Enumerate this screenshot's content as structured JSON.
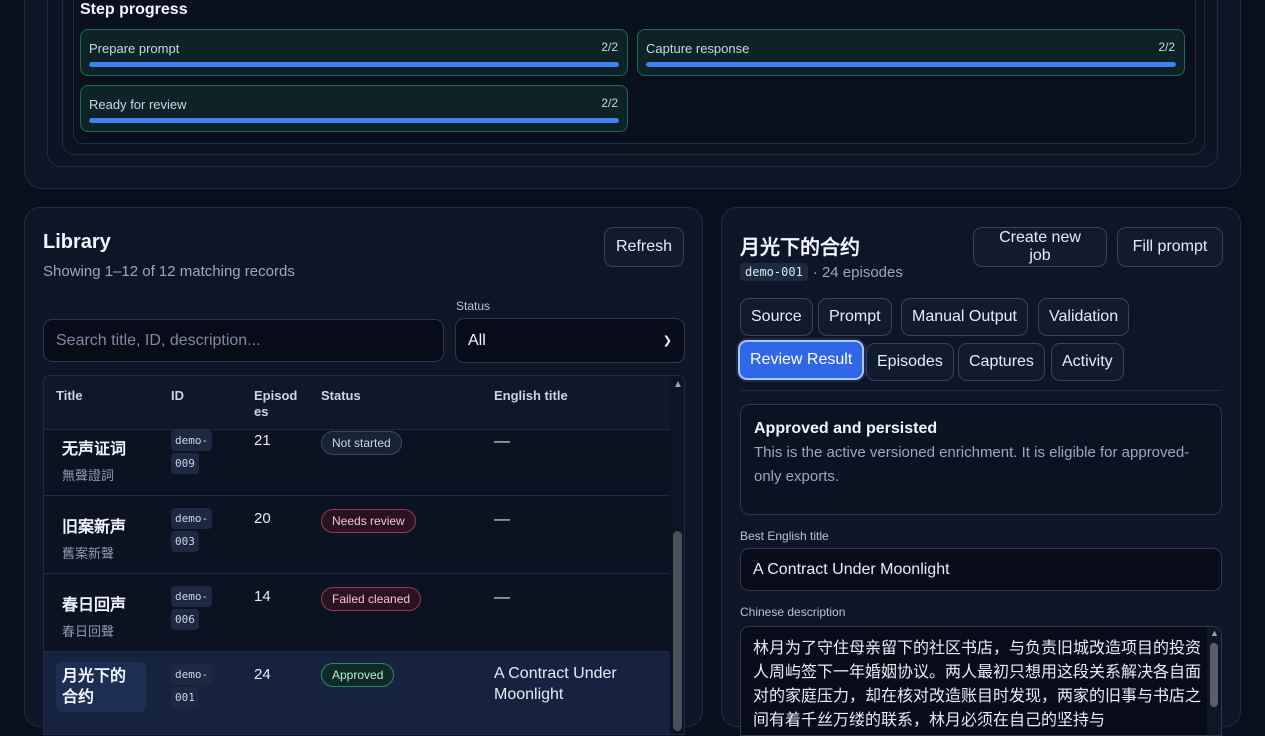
{
  "step_progress": {
    "title": "Step progress",
    "steps": [
      {
        "label": "Prepare prompt",
        "count": "2/2",
        "progress": 1.0
      },
      {
        "label": "Capture response",
        "count": "2/2",
        "progress": 1.0
      },
      {
        "label": "Ready for review",
        "count": "2/2",
        "progress": 1.0
      }
    ]
  },
  "library": {
    "title": "Library",
    "summary": "Showing 1–12 of 12 matching records",
    "refresh_label": "Refresh",
    "search_placeholder": "Search title, ID, description...",
    "status_label": "Status",
    "status_value": "All",
    "columns": [
      "Title",
      "ID",
      "Episod\nes",
      "Status",
      "English title"
    ],
    "rows": [
      {
        "title": "无声证词",
        "subtitle": "無聲證詞",
        "id": [
          "demo-",
          "009"
        ],
        "episodes": "21",
        "status": "Not started",
        "status_color": "gray",
        "english": "—"
      },
      {
        "title": "旧案新声",
        "subtitle": "舊案新聲",
        "id": [
          "demo-",
          "003"
        ],
        "episodes": "20",
        "status": "Needs review",
        "status_color": "red",
        "english": "—"
      },
      {
        "title": "春日回声",
        "subtitle": "春日回聲",
        "id": [
          "demo-",
          "006"
        ],
        "episodes": "14",
        "status": "Failed cleaned",
        "status_color": "red",
        "english": "—"
      },
      {
        "title": "月光下的合约",
        "subtitle": "",
        "id": [
          "demo-",
          "001"
        ],
        "episodes": "24",
        "status": "Approved",
        "status_color": "green",
        "english": "A Contract Under Moonlight"
      }
    ]
  },
  "detail": {
    "title": "月光下的合约",
    "id": "demo-001",
    "episodes_text": "· 24 episodes",
    "create_job_label": "Create new job",
    "fill_prompt_label": "Fill prompt",
    "tabs": [
      "Source",
      "Prompt",
      "Manual Output",
      "Validation",
      "Review Result",
      "Episodes",
      "Captures",
      "Activity"
    ],
    "active_tab": "Review Result",
    "notice_title": "Approved and persisted",
    "notice_body": "This is the active versioned enrichment. It is eligible for approved-only exports.",
    "best_title_label": "Best English title",
    "best_title_value": "A Contract Under Moonlight",
    "cn_desc_label": "Chinese description",
    "cn_desc_value": "林月为了守住母亲留下的社区书店，与负责旧城改造项目的投资人周屿签下一年婚姻协议。两人最初只想用这段关系解决各自面对的家庭压力，却在核对改造账目时发现，两家的旧事与书店之间有着千丝万缕的联系，林月必须在自己的坚持与"
  }
}
